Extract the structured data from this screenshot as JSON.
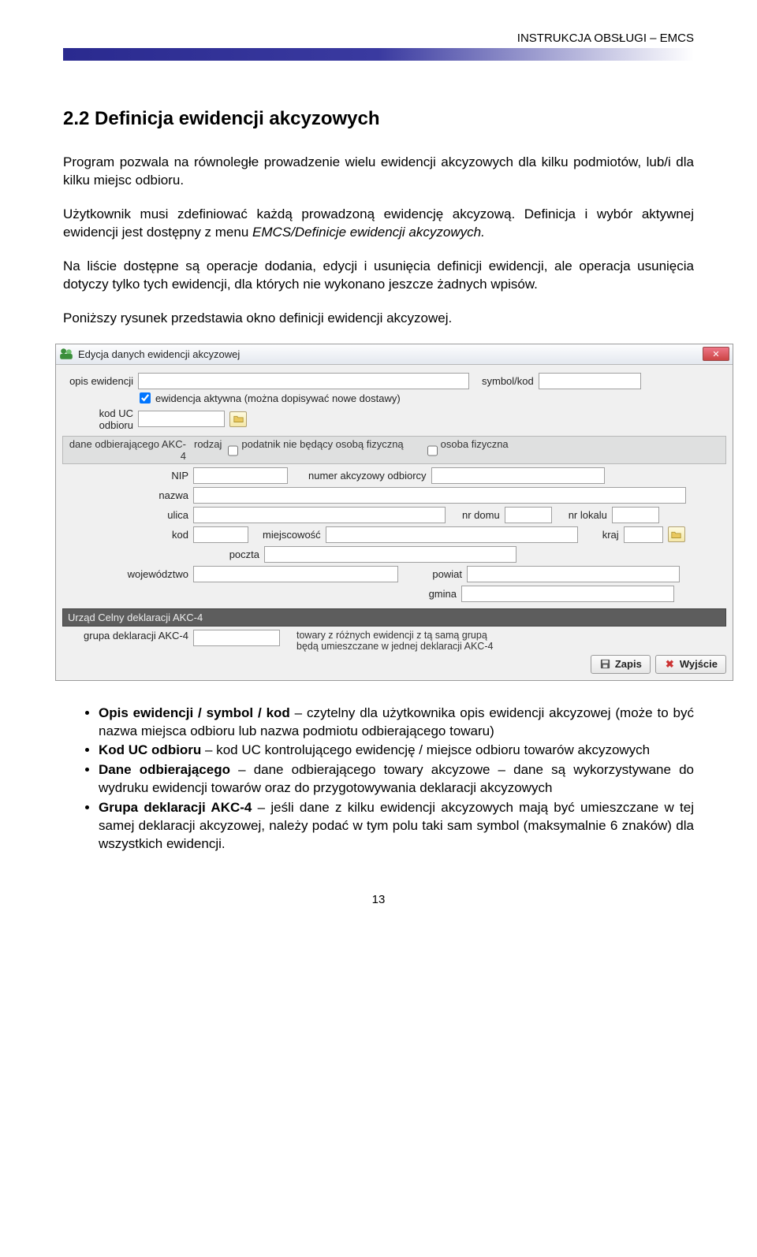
{
  "header": {
    "doc_title": "INSTRUKCJA OBSŁUGI – EMCS"
  },
  "section": {
    "title": "2.2 Definicja ewidencji akcyzowych"
  },
  "paragraphs": {
    "p1": "Program pozwala na równoległe prowadzenie wielu ewidencji akcyzowych dla kilku podmiotów, lub/i dla kilku miejsc odbioru.",
    "p2a": "Użytkownik musi zdefiniować każdą prowadzoną ewidencję akcyzową. Definicja i wybór aktywnej ewidencji jest dostępny z menu ",
    "p2b_italic": "EMCS/Definicje ewidencji akcyzowych.",
    "p3": "Na liście dostępne są operacje dodania, edycji i usunięcia definicji ewidencji, ale operacja usunięcia dotyczy tylko tych ewidencji, dla których nie wykonano jeszcze żadnych wpisów.",
    "p4": "Poniższy rysunek przedstawia okno definicji ewidencji akcyzowej."
  },
  "window": {
    "title": "Edycja danych ewidencji akcyzowej",
    "fields": {
      "opis_label": "opis ewidencji",
      "symbol_label": "symbol/kod",
      "active_label": "ewidencja aktywna (można dopisywać nowe dostawy)",
      "kod_uc_label": "kod UC odbioru",
      "dane_odb_label": "dane odbierającego AKC-4",
      "rodzaj_label": "rodzaj",
      "rodzaj_opt1": "podatnik nie będący osobą fizyczną",
      "rodzaj_opt2": "osoba fizyczna",
      "nip_label": "NIP",
      "numer_akc_label": "numer akcyzowy odbiorcy",
      "nazwa_label": "nazwa",
      "ulica_label": "ulica",
      "nrdomu_label": "nr domu",
      "nrlokalu_label": "nr lokalu",
      "kod_label": "kod",
      "miejscowosc_label": "miejscowość",
      "kraj_label": "kraj",
      "poczta_label": "poczta",
      "wojewodztwo_label": "województwo",
      "powiat_label": "powiat",
      "gmina_label": "gmina"
    },
    "dark1": "Urząd Celny deklaracji AKC-4",
    "grupa_label": "grupa deklaracji AKC-4",
    "grupa_hint1": "towary z różnych ewidencji z tą samą grupą",
    "grupa_hint2": "będą umieszczane w jednej deklaracji AKC-4",
    "buttons": {
      "save": "Zapis",
      "exit": "Wyjście"
    }
  },
  "bullets": {
    "b1a": "Opis ewidencji / symbol / kod",
    "b1b": " – czytelny dla użytkownika opis ewidencji akcyzowej (może to być nazwa miejsca odbioru lub nazwa podmiotu odbierającego towaru)",
    "b2a": "Kod UC odbioru",
    "b2b": " – kod UC kontrolującego ewidencję / miejsce odbioru towarów akcyzowych",
    "b3a": "Dane odbierającego",
    "b3b": " – dane odbierającego towary akcyzowe – dane są wykorzystywane do wydruku ewidencji towarów oraz do przygotowywania deklaracji akcyzowych",
    "b4a": "Grupa deklaracji AKC-4",
    "b4b": " – jeśli dane z kilku ewidencji akcyzowych mają być umieszczane w tej samej deklaracji akcyzowej, należy podać w tym polu taki sam symbol (maksymalnie 6 znaków) dla wszystkich ewidencji."
  },
  "page_number": "13"
}
